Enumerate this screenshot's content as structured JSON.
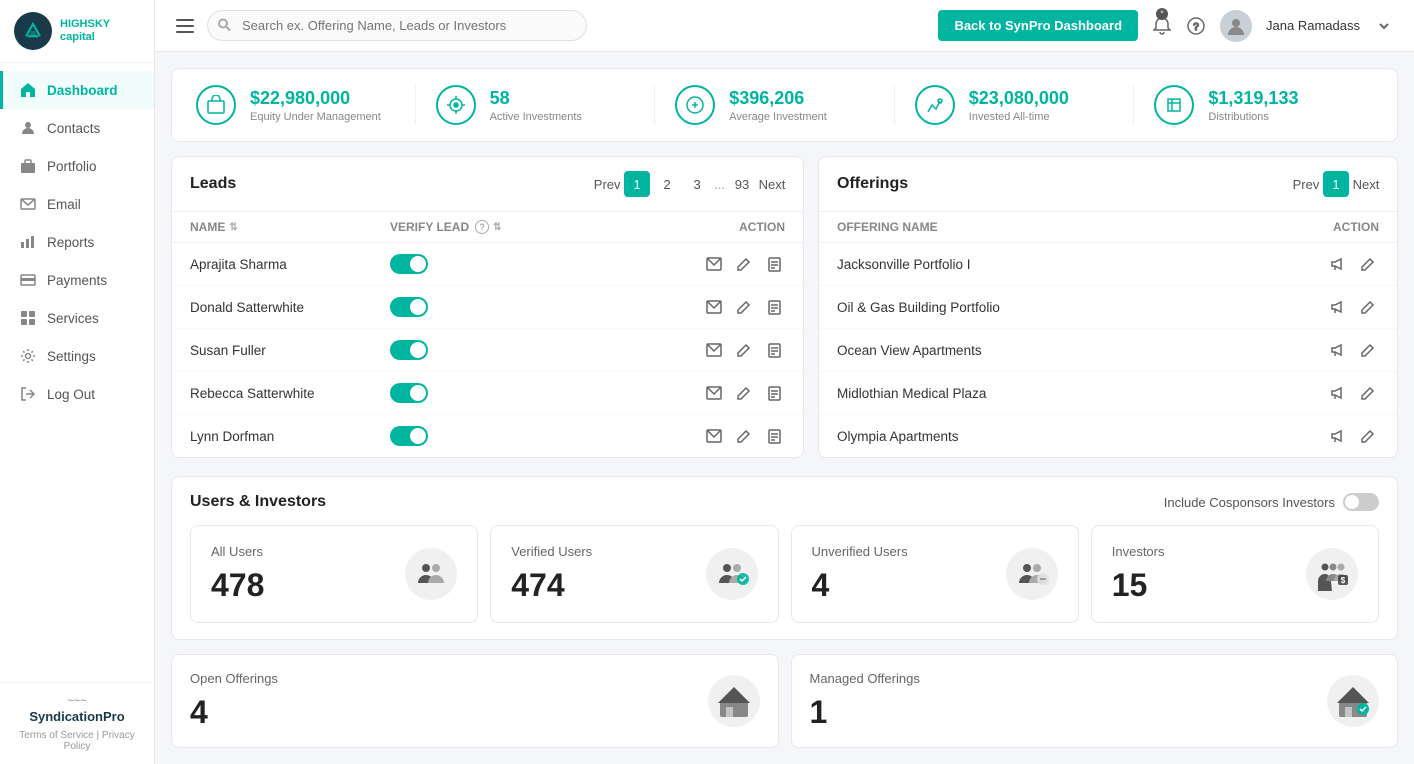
{
  "sidebar": {
    "logo": {
      "name": "HIGHSKY",
      "subtitle": "capital"
    },
    "nav_items": [
      {
        "id": "dashboard",
        "label": "Dashboard",
        "active": true,
        "icon": "home"
      },
      {
        "id": "contacts",
        "label": "Contacts",
        "active": false,
        "icon": "person"
      },
      {
        "id": "portfolio",
        "label": "Portfolio",
        "active": false,
        "icon": "briefcase"
      },
      {
        "id": "email",
        "label": "Email",
        "active": false,
        "icon": "mail"
      },
      {
        "id": "reports",
        "label": "Reports",
        "active": false,
        "icon": "chart"
      },
      {
        "id": "payments",
        "label": "Payments",
        "active": false,
        "icon": "credit-card"
      },
      {
        "id": "services",
        "label": "Services",
        "active": false,
        "icon": "grid"
      },
      {
        "id": "settings",
        "label": "Settings",
        "active": false,
        "icon": "gear"
      },
      {
        "id": "logout",
        "label": "Log Out",
        "active": false,
        "icon": "logout"
      }
    ],
    "footer": {
      "brand": "SyndicationPro",
      "links": [
        "Terms of Service",
        "Privacy Policy"
      ]
    }
  },
  "header": {
    "search_placeholder": "Search ex. Offering Name, Leads or Investors",
    "btn_dashboard": "Back to SynPro Dashboard",
    "user_name": "Jana Ramadass"
  },
  "stats": [
    {
      "value": "$22,980,000",
      "label": "Equity Under Management"
    },
    {
      "value": "58",
      "label": "Active Investments"
    },
    {
      "value": "$396,206",
      "label": "Average Investment"
    },
    {
      "value": "$23,080,000",
      "label": "Invested All-time"
    },
    {
      "value": "$1,319,133",
      "label": "Distributions"
    }
  ],
  "leads": {
    "title": "Leads",
    "columns": {
      "name": "Name",
      "verify_lead": "Verify Lead",
      "action": "Action"
    },
    "pagination": {
      "prev": "Prev",
      "next": "Next",
      "current": 1,
      "pages": [
        1,
        2,
        3,
        "...",
        93
      ]
    },
    "rows": [
      {
        "name": "Aprajita Sharma",
        "verified": true
      },
      {
        "name": "Donald Satterwhite",
        "verified": true
      },
      {
        "name": "Susan Fuller",
        "verified": true
      },
      {
        "name": "Rebecca Satterwhite",
        "verified": true
      },
      {
        "name": "Lynn Dorfman",
        "verified": true
      }
    ]
  },
  "offerings": {
    "title": "Offerings",
    "columns": {
      "name": "Offering Name",
      "action": "Action"
    },
    "pagination": {
      "prev": "Prev",
      "next": "Next",
      "current": 1
    },
    "rows": [
      {
        "name": "Jacksonville Portfolio I"
      },
      {
        "name": "Oil & Gas Building Portfolio"
      },
      {
        "name": "Ocean View Apartments"
      },
      {
        "name": "Midlothian Medical Plaza"
      },
      {
        "name": "Olympia Apartments"
      }
    ]
  },
  "users_investors": {
    "title": "Users & Investors",
    "toggle_label": "Include Cosponsors Investors",
    "cards": [
      {
        "label": "All Users",
        "value": "478"
      },
      {
        "label": "Verified Users",
        "value": "474"
      },
      {
        "label": "Unverified Users",
        "value": "4"
      },
      {
        "label": "Investors",
        "value": "15"
      }
    ]
  },
  "offerings_bottom": {
    "cards": [
      {
        "label": "Open Offerings",
        "value": "4"
      },
      {
        "label": "Managed Offerings",
        "value": "1"
      }
    ]
  }
}
